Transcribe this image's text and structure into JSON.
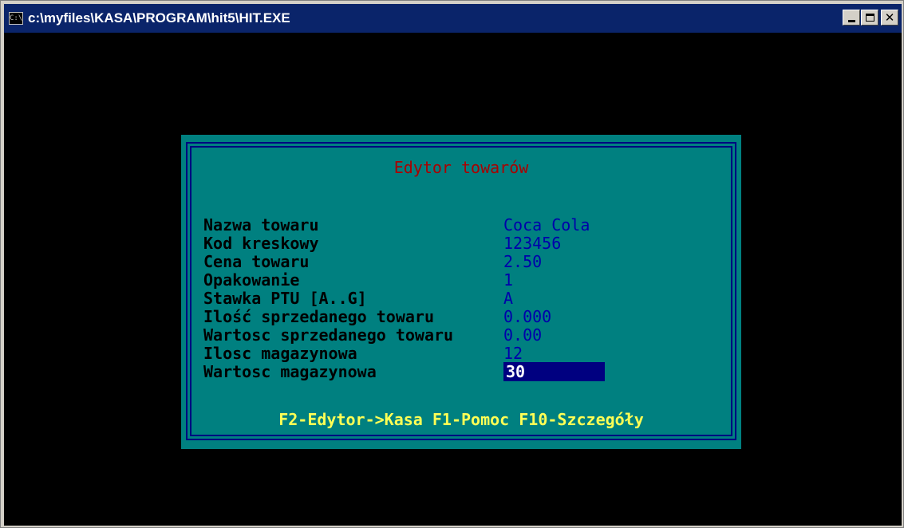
{
  "window": {
    "title": "c:\\myfiles\\KASA\\PROGRAM\\hit5\\HIT.EXE",
    "icon": "console-app-icon",
    "icon_glyph": "C:\\",
    "controls": {
      "minimize": "minimize-icon",
      "maximize": "maximize-icon",
      "close": "close-icon"
    }
  },
  "dialog": {
    "title": "Edytor towarów",
    "fields": [
      {
        "label": "Nazwa towaru",
        "value": "Coca Cola"
      },
      {
        "label": "Kod kreskowy",
        "value": "123456"
      },
      {
        "label": "Cena towaru",
        "value": "2.50"
      },
      {
        "label": "Opakowanie",
        "value": "1"
      },
      {
        "label": "Stawka PTU [A..G]",
        "value": "A"
      },
      {
        "label": "Ilość sprzedanego towaru",
        "value": "0.000"
      },
      {
        "label": "Wartosc sprzedanego towaru",
        "value": "0.00"
      },
      {
        "label": "Ilosc magazynowa",
        "value": "12"
      },
      {
        "label": "Wartosc magazynowa",
        "value": "30"
      }
    ],
    "footer": "F2-Edytor->Kasa F1-Pomoc F10-Szczegóły"
  },
  "colors": {
    "titlebar": "#0a246a",
    "console_bg": "#000000",
    "dialog_bg": "#008080",
    "frame": "#000080",
    "title_text": "#aa0000",
    "label_text": "#000000",
    "value_text": "#0000aa",
    "footer_text": "#ffff55",
    "active_field_bg": "#000080"
  }
}
